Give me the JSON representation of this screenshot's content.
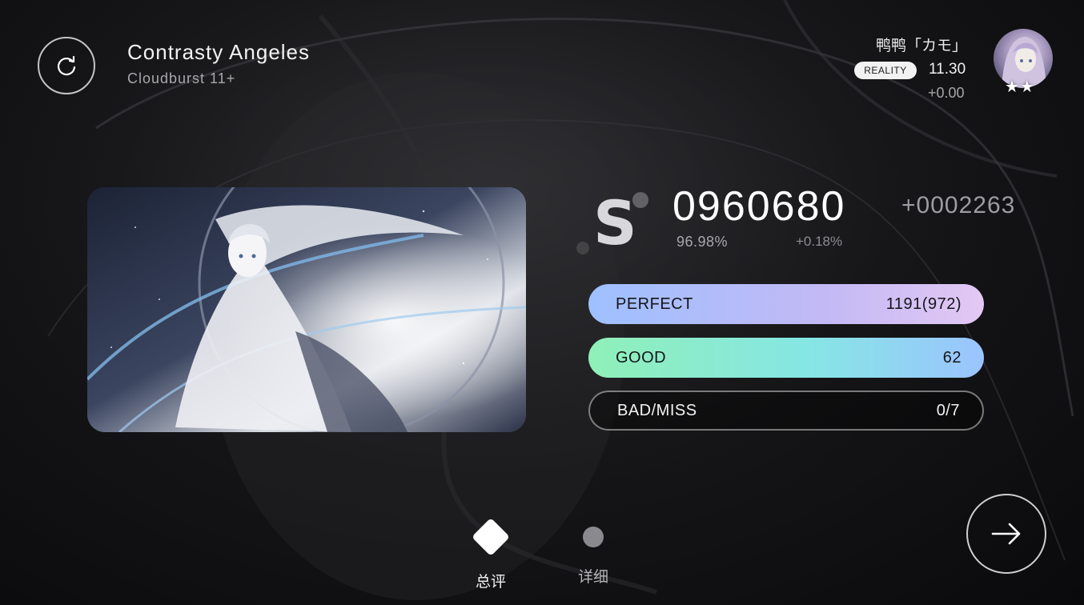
{
  "song": {
    "title": "Contrasty Angeles",
    "level": "Cloudburst 11+"
  },
  "player": {
    "name": "鸭鸭「カモ」",
    "badge": "REALITY",
    "rks": "11.30",
    "rks_delta": "+0.00",
    "stars": "★★"
  },
  "result": {
    "rank": "S",
    "score": "0960680",
    "score_delta": "+0002263",
    "accuracy": "96.98%",
    "accuracy_delta": "+0.18%"
  },
  "judgements": {
    "perfect": {
      "label": "PERFECT",
      "value": "1191(972)"
    },
    "good": {
      "label": "GOOD",
      "value": "62"
    },
    "bad_miss": {
      "label": "BAD/MISS",
      "value": "0/7"
    }
  },
  "tabs": {
    "summary": "总评",
    "detail": "详细"
  },
  "icons": {
    "retry": "retry-icon",
    "next": "arrow-right-icon"
  }
}
